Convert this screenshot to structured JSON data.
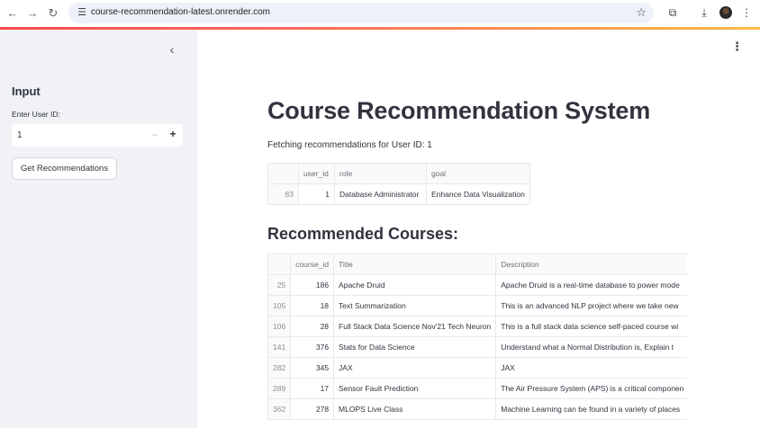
{
  "browser": {
    "url": "course-recommendation-latest.onrender.com"
  },
  "sidebar": {
    "heading": "Input",
    "user_id_label": "Enter User ID:",
    "user_id_value": "1",
    "button_label": "Get Recommendations"
  },
  "main": {
    "title": "Course Recommendation System",
    "fetch_text": "Fetching recommendations for User ID: 1",
    "user_table": {
      "columns": [
        "",
        "user_id",
        "role",
        "goal"
      ],
      "rows": [
        {
          "index": "83",
          "user_id": "1",
          "role": "Database Administrator",
          "goal": "Enhance Data Visualization"
        }
      ]
    },
    "recommended_heading": "Recommended Courses:",
    "course_table": {
      "columns": [
        "",
        "course_id",
        "Title",
        "Description"
      ],
      "rows": [
        {
          "index": "25",
          "course_id": "186",
          "title": "Apache Druid",
          "description": "Apache Druid is a real-time database to power mode"
        },
        {
          "index": "105",
          "course_id": "18",
          "title": "Text Summarization",
          "description": "This is an advanced NLP project where we take new"
        },
        {
          "index": "106",
          "course_id": "28",
          "title": "Full Stack Data Science Nov'21 Tech Neuron",
          "description": "This is a full stack data science self-paced course wi"
        },
        {
          "index": "141",
          "course_id": "376",
          "title": "Stats for Data Science",
          "description": "Understand what a Normal Distribution is, Explain t"
        },
        {
          "index": "282",
          "course_id": "345",
          "title": "JAX",
          "description": "JAX"
        },
        {
          "index": "289",
          "course_id": "17",
          "title": "Sensor Fault Prediction",
          "description": "The Air Pressure System (APS) is a critical componen"
        },
        {
          "index": "362",
          "course_id": "278",
          "title": "MLOPS Live Class",
          "description": "Machine Learning can be found in a variety of places"
        }
      ]
    }
  },
  "colors": {
    "sidebar_bg": "#f0f2f6",
    "accent": "#ff4b4b",
    "text": "#31333f"
  }
}
